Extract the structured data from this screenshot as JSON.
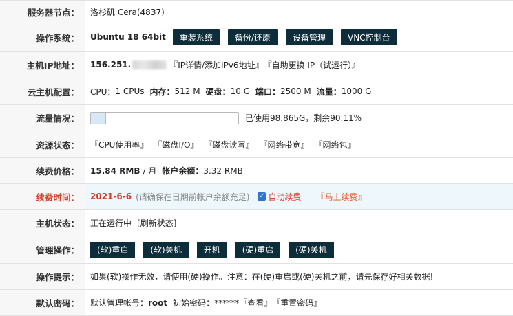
{
  "rows": {
    "node": {
      "label": "服务器节点：",
      "value": "洛杉矶 Cera(4837)"
    },
    "os": {
      "label": "操作系统：",
      "value": "Ubuntu 18 64bit",
      "buttons": [
        "重装系统",
        "备份/还原",
        "设备管理",
        "VNC控制台"
      ]
    },
    "ip": {
      "label": "主机IP地址：",
      "value": "156.251.",
      "link_details": "『IP详情/添加IPv6地址』",
      "link_change": "『自助更换 IP（试运行）』"
    },
    "config": {
      "label": "云主机配置：",
      "cpu_label": "CPU：",
      "cpu": "1 CPUs",
      "mem_label": "内存：",
      "mem": "512 M",
      "disk_label": "硬盘：",
      "disk": "10 G",
      "port_label": "端口：",
      "port": "2500 M",
      "traffic_label": "流量：",
      "traffic": "1000 G"
    },
    "traffic": {
      "label": "流量情况：",
      "used_fraction": 0.099,
      "text": "已使用98.865G，剩余90.11%"
    },
    "resources": {
      "label": "资源状态：",
      "links": [
        "『CPU使用率』",
        "『磁盘I/O』",
        "『磁盘读写』",
        "『网络带宽』",
        "『网络包』"
      ]
    },
    "price": {
      "label": "续费价格：",
      "price": "15.84 RMB",
      "unit": "/ 月",
      "balance_label": "帐户余额：",
      "balance": "3.32 RMB"
    },
    "renew": {
      "label": "续费时间：",
      "date": "2021-6-6",
      "hint": "(请确保在日期前帐户余额充足)",
      "auto": "自动续费",
      "renew_now": "『马上续费』"
    },
    "status": {
      "label": "主机状态：",
      "value": "正在运行中",
      "refresh": "[刷新状态]"
    },
    "manage": {
      "label": "管理操作：",
      "buttons": [
        "(软)重启",
        "(软)关机",
        "开机",
        "(硬)重启",
        "(硬)关机"
      ]
    },
    "tips": {
      "label": "操作提示：",
      "value": "如果(软)操作无效，请使用(硬)操作。注意：在(硬)重启或(硬)关机之前，请先保存好相关数据!"
    },
    "password": {
      "label": "默认密码：",
      "account_label": "默认管理帐号：",
      "account": "root",
      "pwd_label": "初始密码：",
      "pwd": "******",
      "view": "『查看』",
      "reset": "『重置密码』"
    }
  },
  "colors": {
    "button_bg": "#0d2d3a",
    "label_bg": "#f7f7f7",
    "renew_bg": "#eef7fb",
    "red": "#d23c2a",
    "orange": "#e8582c",
    "checkbox": "#2f74d0"
  }
}
